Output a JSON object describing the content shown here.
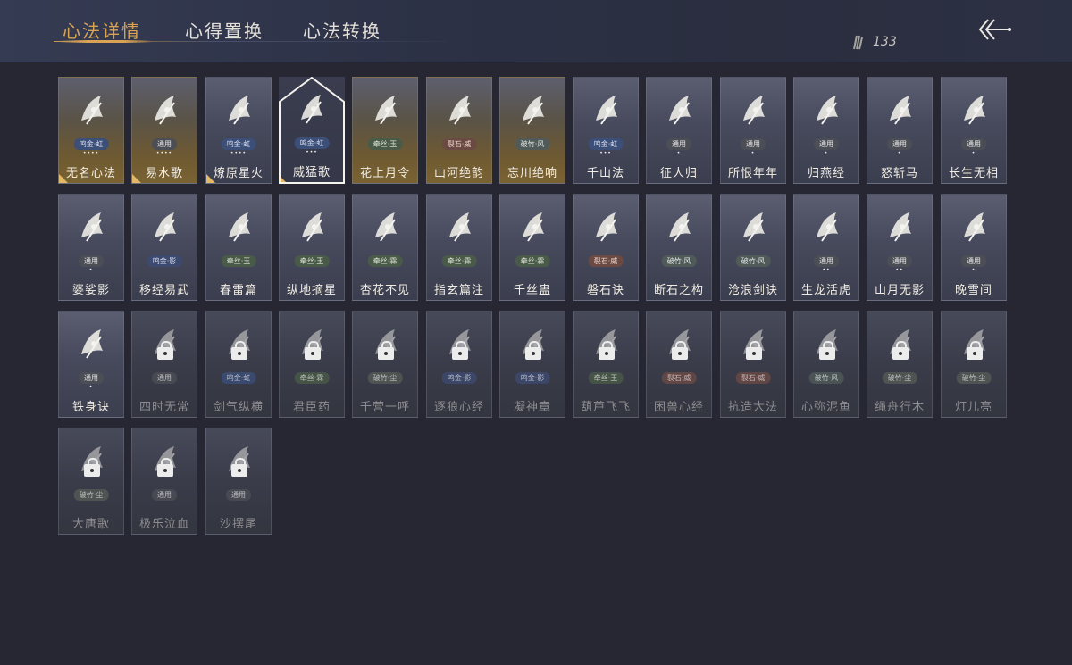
{
  "tabs": [
    {
      "label": "心法详情",
      "active": true
    },
    {
      "label": "心得置换",
      "active": false
    },
    {
      "label": "心法转换",
      "active": false
    }
  ],
  "currency": {
    "icon": "feather-icon",
    "value": "133"
  },
  "back": {
    "icon": "back-arrow-icon"
  },
  "colors": {
    "accent": "#d9a255",
    "background": "#262733"
  },
  "cards": [
    {
      "name": "无名心法",
      "tag": "鸣金·虹",
      "tagType": "t-red",
      "dots": "••••",
      "style": "gold",
      "corner": true,
      "icon": "sword-icon"
    },
    {
      "name": "易水歌",
      "tag": "通用",
      "tagType": "t-tong",
      "dots": "••••",
      "style": "gold",
      "corner": true,
      "icon": "horse-icon"
    },
    {
      "name": "燎原星火",
      "tag": "鸣金·虹",
      "tagType": "t-red",
      "dots": "••••",
      "style": "normal",
      "corner": true,
      "icon": "spear-icon"
    },
    {
      "name": "威猛歌",
      "tag": "鸣金·虹",
      "tagType": "t-red",
      "dots": "•••",
      "style": "selected",
      "corner": true,
      "icon": "fist-icon"
    },
    {
      "name": "花上月令",
      "tag": "牵丝·玉",
      "tagType": "t-yu",
      "dots": "",
      "style": "gold",
      "corner": false,
      "icon": "flower-icon"
    },
    {
      "name": "山河绝韵",
      "tag": "裂石·威",
      "tagType": "t-wei",
      "dots": "",
      "style": "gold",
      "corner": false,
      "icon": "mountain-icon"
    },
    {
      "name": "忘川绝响",
      "tag": "破竹·风",
      "tagType": "t-feng",
      "dots": "",
      "style": "gold",
      "corner": false,
      "icon": "mask-icon"
    },
    {
      "name": "千山法",
      "tag": "鸣金·虹",
      "tagType": "t-red",
      "dots": "•••",
      "style": "normal",
      "corner": false,
      "icon": "peaks-icon"
    },
    {
      "name": "征人归",
      "tag": "通用",
      "tagType": "t-tong",
      "dots": "•",
      "style": "normal",
      "corner": false,
      "icon": "bird-hand-icon"
    },
    {
      "name": "所恨年年",
      "tag": "通用",
      "tagType": "t-tong",
      "dots": "•",
      "style": "normal",
      "corner": false,
      "icon": "bamboo-icon"
    },
    {
      "name": "归燕经",
      "tag": "通用",
      "tagType": "t-tong",
      "dots": "•",
      "style": "normal",
      "corner": false,
      "icon": "swallow-icon"
    },
    {
      "name": "怒斩马",
      "tag": "通用",
      "tagType": "t-tong",
      "dots": "•",
      "style": "normal",
      "corner": false,
      "icon": "blade-icon"
    },
    {
      "name": "长生无相",
      "tag": "通用",
      "tagType": "t-tong",
      "dots": "•",
      "style": "normal",
      "corner": false,
      "icon": "figure-icon"
    },
    {
      "name": "婆娑影",
      "tag": "通用",
      "tagType": "t-tong",
      "dots": "•",
      "style": "normal",
      "corner": false,
      "icon": "dragon-icon"
    },
    {
      "name": "移经易武",
      "tag": "鸣金·影",
      "tagType": "t-ying",
      "dots": "",
      "style": "normal",
      "corner": false,
      "icon": "warrior-icon"
    },
    {
      "name": "春雷篇",
      "tag": "牵丝·玉",
      "tagType": "t-yu",
      "dots": "",
      "style": "normal",
      "corner": false,
      "icon": "lightning-icon"
    },
    {
      "name": "纵地摘星",
      "tag": "牵丝·玉",
      "tagType": "t-yu",
      "dots": "",
      "style": "normal",
      "corner": false,
      "icon": "hand-star-icon"
    },
    {
      "name": "杏花不见",
      "tag": "牵丝·霖",
      "tagType": "t-yu",
      "dots": "",
      "style": "normal",
      "corner": false,
      "icon": "blossom-icon"
    },
    {
      "name": "指玄篇注",
      "tag": "牵丝·霖",
      "tagType": "t-yu",
      "dots": "",
      "style": "normal",
      "corner": false,
      "icon": "yinyang-icon"
    },
    {
      "name": "千丝蛊",
      "tag": "牵丝·霖",
      "tagType": "t-yu",
      "dots": "",
      "style": "normal",
      "corner": false,
      "icon": "leaf-icon"
    },
    {
      "name": "磐石诀",
      "tag": "裂石·威",
      "tagType": "t-wei",
      "dots": "",
      "style": "normal",
      "corner": false,
      "icon": "rock-icon"
    },
    {
      "name": "断石之构",
      "tag": "破竹·风",
      "tagType": "t-feng",
      "dots": "",
      "style": "normal",
      "corner": false,
      "icon": "swordsman-icon"
    },
    {
      "name": "沧浪剑诀",
      "tag": "破竹·风",
      "tagType": "t-feng",
      "dots": "",
      "style": "normal",
      "corner": false,
      "icon": "serpent-icon"
    },
    {
      "name": "生龙活虎",
      "tag": "通用",
      "tagType": "t-tong",
      "dots": "••",
      "style": "normal",
      "corner": false,
      "icon": "swirl-icon"
    },
    {
      "name": "山月无影",
      "tag": "通用",
      "tagType": "t-tong",
      "dots": "••",
      "style": "normal",
      "corner": false,
      "icon": "strike-icon"
    },
    {
      "name": "晚雪间",
      "tag": "通用",
      "tagType": "t-tong",
      "dots": "•",
      "style": "normal",
      "corner": false,
      "icon": "cross-icon"
    },
    {
      "name": "铁身诀",
      "tag": "通用",
      "tagType": "t-tong",
      "dots": "•",
      "style": "normal",
      "corner": false,
      "icon": "muscle-icon"
    },
    {
      "name": "四时无常",
      "tag": "通用",
      "tagType": "t-tong",
      "dots": "",
      "style": "locked",
      "corner": false,
      "icon": "beast-icon"
    },
    {
      "name": "剑气纵横",
      "tag": "鸣金·虹",
      "tagType": "t-red",
      "dots": "",
      "style": "locked",
      "corner": false,
      "icon": "swords-icon"
    },
    {
      "name": "君臣药",
      "tag": "牵丝·霖",
      "tagType": "t-yu",
      "dots": "",
      "style": "locked",
      "corner": false,
      "icon": "herb-icon"
    },
    {
      "name": "千营一呼",
      "tag": "破竹·尘",
      "tagType": "t-chen",
      "dots": "",
      "style": "locked",
      "corner": false,
      "icon": "banner-icon"
    },
    {
      "name": "逐狼心经",
      "tag": "鸣金·影",
      "tagType": "t-ying",
      "dots": "",
      "style": "locked",
      "corner": false,
      "icon": "wolf-icon"
    },
    {
      "name": "凝神章",
      "tag": "鸣金·影",
      "tagType": "t-ying",
      "dots": "",
      "style": "locked",
      "corner": false,
      "icon": "crescent-icon"
    },
    {
      "name": "葫芦飞飞",
      "tag": "牵丝·玉",
      "tagType": "t-yu",
      "dots": "",
      "style": "locked",
      "corner": false,
      "icon": "gourd-icon"
    },
    {
      "name": "困兽心经",
      "tag": "裂石·威",
      "tagType": "t-wei",
      "dots": "",
      "style": "locked",
      "corner": false,
      "icon": "chain-icon"
    },
    {
      "name": "抗造大法",
      "tag": "裂石·威",
      "tagType": "t-wei",
      "dots": "",
      "style": "locked",
      "corner": false,
      "icon": "bell-icon"
    },
    {
      "name": "心弥泥鱼",
      "tag": "破竹·风",
      "tagType": "t-feng",
      "dots": "",
      "style": "locked",
      "corner": false,
      "icon": "fish-icon"
    },
    {
      "name": "绳舟行木",
      "tag": "破竹·尘",
      "tagType": "t-chen",
      "dots": "",
      "style": "locked",
      "corner": false,
      "icon": "boat-icon"
    },
    {
      "name": "灯儿亮",
      "tag": "破竹·尘",
      "tagType": "t-chen",
      "dots": "",
      "style": "locked",
      "corner": false,
      "icon": "lamp-icon"
    },
    {
      "name": "大唐歌",
      "tag": "破竹·尘",
      "tagType": "t-chen",
      "dots": "",
      "style": "locked",
      "corner": false,
      "icon": "palace-icon"
    },
    {
      "name": "极乐泣血",
      "tag": "通用",
      "tagType": "t-tong",
      "dots": "",
      "style": "locked",
      "corner": false,
      "icon": "scythe-icon"
    },
    {
      "name": "沙摆尾",
      "tag": "通用",
      "tagType": "t-tong",
      "dots": "",
      "style": "locked",
      "corner": false,
      "icon": "wave-icon"
    }
  ]
}
